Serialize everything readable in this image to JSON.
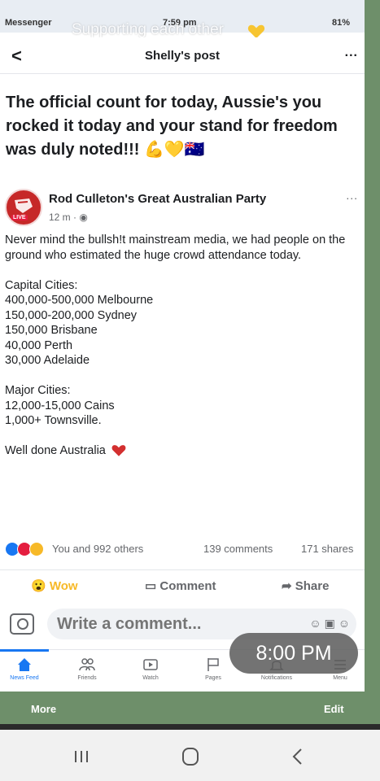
{
  "status_bar": {
    "left": "Messenger",
    "time": "7:59 pm",
    "battery": "81%"
  },
  "overlay": {
    "banner": "Supporting each other",
    "time": "8:00 PM",
    "more": "More",
    "edit": "Edit"
  },
  "topbar": {
    "back": "<",
    "title": "Shelly's post",
    "more": "..."
  },
  "post": {
    "text": "The official count for today, Aussie's you rocked it today and your stand for freedom was duly noted!!! 💪💛🇦🇺"
  },
  "shared": {
    "live_badge": "LIVE",
    "page_name": "Rod Culleton's Great Australian Party",
    "time": "12 m",
    "more": "...",
    "intro": "Never mind the bullsh!t mainstream media, we had people on the ground who estimated the huge crowd attendance today.",
    "capital_heading": "Capital Cities:",
    "capitals": [
      "400,000-500,000 Melbourne",
      "150,000-200,000 Sydney",
      "150,000 Brisbane",
      "40,000 Perth",
      "30,000 Adelaide"
    ],
    "major_heading": "Major Cities:",
    "majors": [
      "12,000-15,000 Cains",
      "1,000+ Townsville."
    ],
    "closing": "Well done Australia"
  },
  "reactions": {
    "you_and_others": "You and 992 others",
    "comments": "139 comments",
    "shares": "171 shares"
  },
  "actions": {
    "wow": "Wow",
    "comment": "Comment",
    "share": "Share"
  },
  "comment_bar": {
    "placeholder": "Write a comment..."
  },
  "tabs": [
    {
      "label": "News Feed",
      "active": true
    },
    {
      "label": "Friends"
    },
    {
      "label": "Watch"
    },
    {
      "label": "Pages"
    },
    {
      "label": "Notifications"
    },
    {
      "label": "Menu"
    }
  ],
  "colors": {
    "facebook_blue": "#1877f2",
    "wow_yellow": "#f7b928",
    "love_red": "#e41e3f"
  }
}
